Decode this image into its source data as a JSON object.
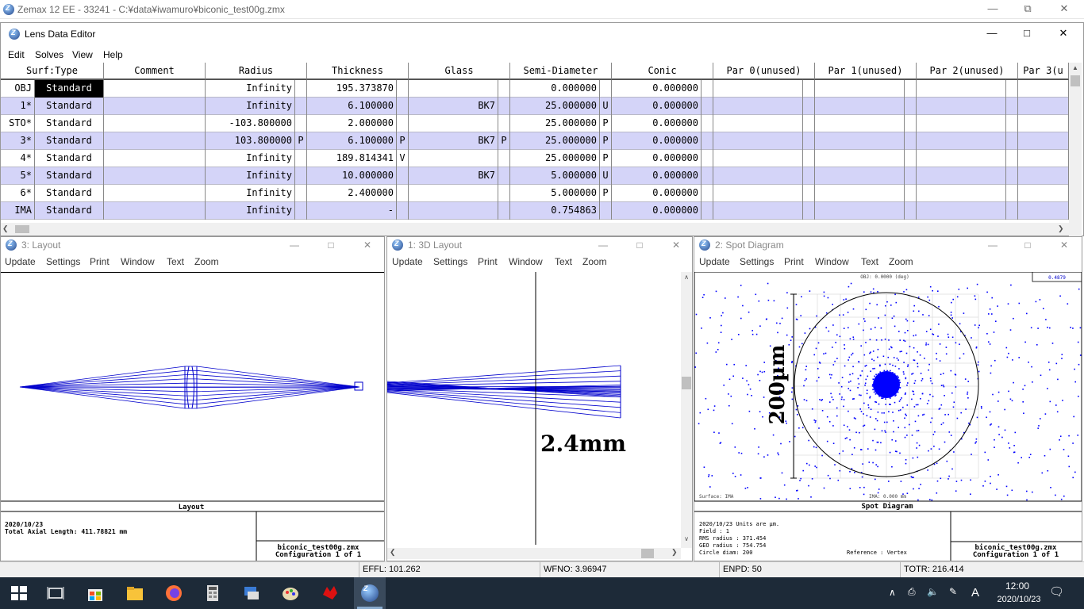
{
  "app_title": "Zemax 12 EE - 33241 - C:¥data¥iwamuro¥biconic_test00g.zmx",
  "lde": {
    "title": "Lens Data Editor",
    "menu": [
      "Edit",
      "Solves",
      "View",
      "Help"
    ],
    "columns": [
      "Surf:Type",
      "Comment",
      "Radius",
      "Thickness",
      "Glass",
      "Semi-Diameter",
      "Conic",
      "Par 0(unused)",
      "Par 1(unused)",
      "Par 2(unused)",
      "Par 3(u"
    ],
    "rows": [
      {
        "surf": "OBJ",
        "type": "Standard",
        "comment": "",
        "radius": "Infinity",
        "rs": "",
        "thick": "195.373870",
        "ts": "",
        "glass": "",
        "gs": "",
        "semi": "0.000000",
        "ss": "",
        "conic": "0.000000"
      },
      {
        "surf": "1*",
        "type": "Standard",
        "comment": "",
        "radius": "Infinity",
        "rs": "",
        "thick": "6.100000",
        "ts": "",
        "glass": "BK7",
        "gs": "",
        "semi": "25.000000",
        "ss": "U",
        "conic": "0.000000"
      },
      {
        "surf": "STO*",
        "type": "Standard",
        "comment": "",
        "radius": "-103.800000",
        "rs": "",
        "thick": "2.000000",
        "ts": "",
        "glass": "",
        "gs": "",
        "semi": "25.000000",
        "ss": "P",
        "conic": "0.000000"
      },
      {
        "surf": "3*",
        "type": "Standard",
        "comment": "",
        "radius": "103.800000",
        "rs": "P",
        "thick": "6.100000",
        "ts": "P",
        "glass": "BK7",
        "gs": "P",
        "semi": "25.000000",
        "ss": "P",
        "conic": "0.000000"
      },
      {
        "surf": "4*",
        "type": "Standard",
        "comment": "",
        "radius": "Infinity",
        "rs": "",
        "thick": "189.814341",
        "ts": "V",
        "glass": "",
        "gs": "",
        "semi": "25.000000",
        "ss": "P",
        "conic": "0.000000"
      },
      {
        "surf": "5*",
        "type": "Standard",
        "comment": "",
        "radius": "Infinity",
        "rs": "",
        "thick": "10.000000",
        "ts": "",
        "glass": "BK7",
        "gs": "",
        "semi": "5.000000",
        "ss": "U",
        "conic": "0.000000"
      },
      {
        "surf": "6*",
        "type": "Standard",
        "comment": "",
        "radius": "Infinity",
        "rs": "",
        "thick": "2.400000",
        "ts": "",
        "glass": "",
        "gs": "",
        "semi": "5.000000",
        "ss": "P",
        "conic": "0.000000"
      },
      {
        "surf": "IMA",
        "type": "Standard",
        "comment": "",
        "radius": "Infinity",
        "rs": "",
        "thick": "-",
        "ts": "",
        "glass": "",
        "gs": "",
        "semi": "0.754863",
        "ss": "",
        "conic": "0.000000"
      }
    ]
  },
  "layout": {
    "title": "3: Layout",
    "menu": [
      "Update",
      "Settings",
      "Print",
      "Window",
      "Text",
      "Zoom"
    ],
    "caption": "Layout",
    "date": "2020/10/23",
    "axial": "Total Axial Length:  411.78821 mm",
    "file": "biconic_test00g.zmx",
    "config": "Configuration 1 of 1"
  },
  "layout3d": {
    "title": "1: 3D Layout",
    "menu": [
      "Update",
      "Settings",
      "Print",
      "Window",
      "Text",
      "Zoom"
    ],
    "annotation": "2.4mm"
  },
  "spot": {
    "title": "2: Spot Diagram",
    "menu": [
      "Update",
      "Settings",
      "Print",
      "Window",
      "Text",
      "Zoom"
    ],
    "top_label": "OBJ: 0.0000 (deg)",
    "corner_label": "0.4879",
    "surface_label": "Surface: IMA",
    "ima_label": "IMA: 0.000 mm",
    "scale_label": "200µm",
    "caption": "Spot Diagram",
    "info": [
      "2020/10/23  Units are µm.",
      "Field       :      1",
      "RMS radius  :    371.454",
      "GEO radius  :    754.754",
      "Circle diam: 200"
    ],
    "reference": "Reference  : Vertex",
    "file": "biconic_test00g.zmx",
    "config": "Configuration 1 of 1"
  },
  "status": [
    "EFFL: 101.262",
    "WFNO: 3.96947",
    "ENPD: 50",
    "TOTR: 216.414"
  ],
  "taskbar": {
    "time": "12:00",
    "date": "2020/10/23",
    "ime": "A"
  },
  "colors": {
    "ray": "#0000cc",
    "spot": "#0000ff",
    "alt_row": "#d4d4f8"
  }
}
